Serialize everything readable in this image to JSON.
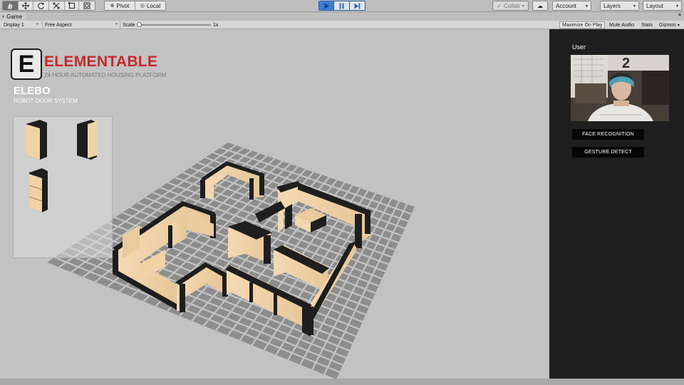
{
  "toolbar": {
    "tools": [
      "hand-tool-icon",
      "move-tool-icon",
      "rotate-tool-icon",
      "scale-tool-icon",
      "rect-tool-icon",
      "transform-tool-icon"
    ],
    "pivot_label": "Pivot",
    "local_label": "Local",
    "collab_label": "Collab",
    "account_label": "Account",
    "layers_label": "Layers",
    "layout_label": "Layout"
  },
  "tab": {
    "label": "Game"
  },
  "game_controls": {
    "display": "Display 1",
    "aspect": "Free Aspect",
    "scale_label": "Scale",
    "scale_value": "1x",
    "maximize_label": "Maximize On Play",
    "mute_label": "Mute Audio",
    "stats_label": "Stats",
    "gizmos_label": "Gizmos"
  },
  "brand": {
    "logo_letter": "E",
    "name": "ELEMENTABLE",
    "tagline": "24-HOUR AUTOMATED HOUSING PLATFORM",
    "product": "ELEBO",
    "product_subtitle": "ROBOT DOOR SYSTEM"
  },
  "sidebar": {
    "user_label": "User",
    "face_button": "FACE RECOGNITION",
    "gesture_button": "GESTURE DETECT"
  },
  "colors": {
    "accent_red": "#c42a2a",
    "play_blue": "#3d7fd6",
    "panel_dark": "#1e1e1e",
    "wall_wood": "#efd2a6",
    "wall_edge": "#1c1c1c"
  }
}
